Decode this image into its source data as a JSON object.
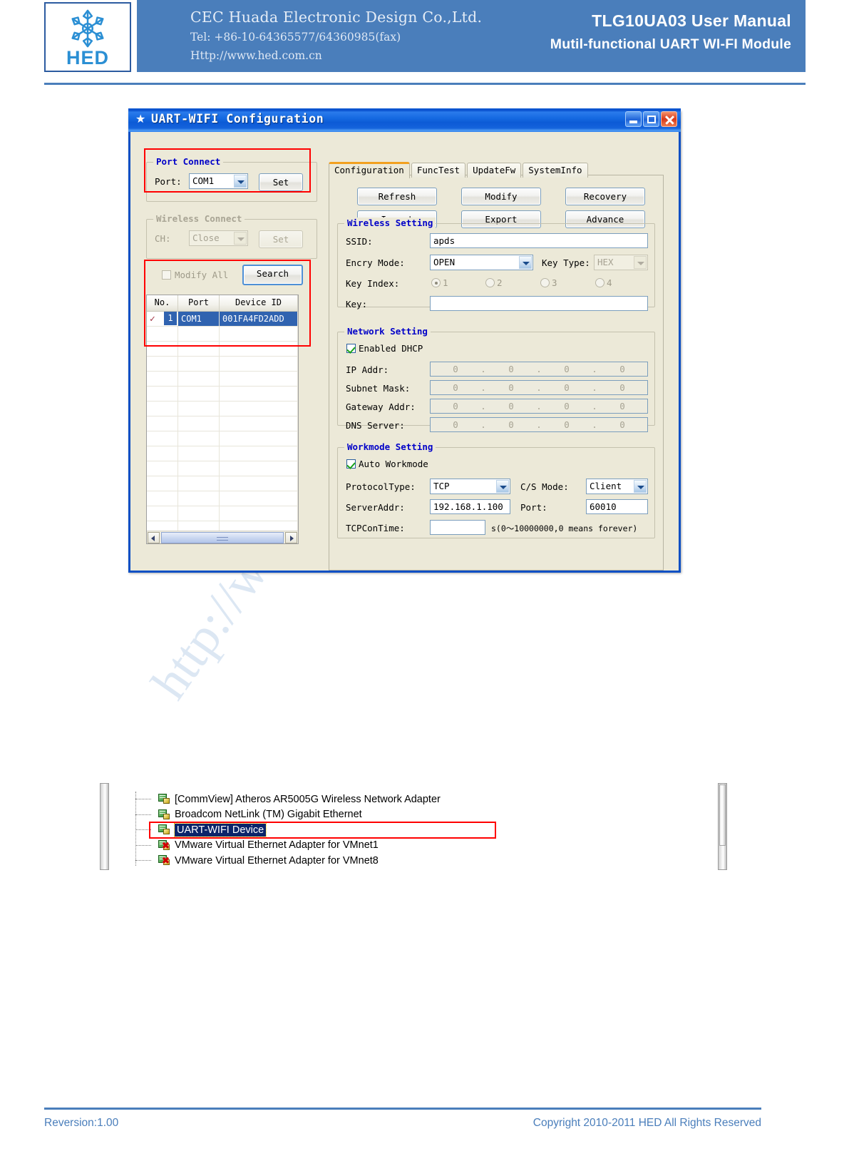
{
  "header": {
    "logo_text": "HED",
    "company_name": "CEC Huada Electronic Design Co.,Ltd.",
    "tel": "Tel: +86-10-64365577/64360985(fax)",
    "url": "Http://www.hed.com.cn",
    "manual_title": "TLG10UA03 User Manual",
    "manual_subtitle": "Mutil-functional UART WI-FI Module"
  },
  "watermark": {
    "text": "http://www.hed.com.cn"
  },
  "dialog": {
    "title": "UART-WIFI Configuration",
    "title_icon": "star-icon",
    "window_buttons": {
      "minimize": "minimize-icon",
      "maximize": "maximize-icon",
      "close": "close-icon"
    },
    "port_connect": {
      "group_label": "Port Connect",
      "port_label": "Port:",
      "port_value": "COM1",
      "set_button": "Set"
    },
    "wireless_connect": {
      "group_label": "Wireless Connect",
      "ch_label": "CH:",
      "ch_value": "Close",
      "set_button": "Set"
    },
    "search_row": {
      "modify_all_label": "Modify All",
      "modify_all_checked": false,
      "search_button": "Search"
    },
    "device_grid": {
      "columns": [
        "No.",
        "Port",
        "Device ID"
      ],
      "rows": [
        {
          "checked": true,
          "no": "1",
          "port": "COM1",
          "device_id": "001FA4FD2ADD",
          "selected": true
        }
      ],
      "empty_rows": 14
    },
    "tabs": [
      {
        "label": "Configuration",
        "active": true
      },
      {
        "label": "FuncTest",
        "active": false
      },
      {
        "label": "UpdateFw",
        "active": false
      },
      {
        "label": "SystemInfo",
        "active": false
      }
    ],
    "actions": [
      "Refresh",
      "Modify",
      "Recovery",
      "Import",
      "Export",
      "Advance"
    ],
    "wireless_setting": {
      "group_label": "Wireless Setting",
      "ssid_label": "SSID:",
      "ssid_value": "apds",
      "encry_mode_label": "Encry Mode:",
      "encry_mode_value": "OPEN",
      "key_type_label": "Key Type:",
      "key_type_value": "HEX",
      "key_index_label": "Key Index:",
      "key_index_options": [
        "1",
        "2",
        "3",
        "4"
      ],
      "key_index_selected": "1",
      "key_label": "Key:",
      "key_value": ""
    },
    "network_setting": {
      "group_label": "Network Setting",
      "dhcp_label": "Enabled DHCP",
      "dhcp_checked": true,
      "fields": [
        {
          "label": "IP Addr:",
          "octets": [
            "0",
            "0",
            "0",
            "0"
          ]
        },
        {
          "label": "Subnet Mask:",
          "octets": [
            "0",
            "0",
            "0",
            "0"
          ]
        },
        {
          "label": "Gateway Addr:",
          "octets": [
            "0",
            "0",
            "0",
            "0"
          ]
        },
        {
          "label": "DNS Server:",
          "octets": [
            "0",
            "0",
            "0",
            "0"
          ]
        }
      ]
    },
    "workmode_setting": {
      "group_label": "Workmode Setting",
      "auto_label": "Auto Workmode",
      "auto_checked": true,
      "protocol_label": "ProtocolType:",
      "protocol_value": "TCP",
      "cs_mode_label": "C/S Mode:",
      "cs_mode_value": "Client",
      "server_addr_label": "ServerAddr:",
      "server_addr_value": "192.168.1.100",
      "port_label": "Port:",
      "port_value": "60010",
      "tcpcontime_label": "TCPConTime:",
      "tcpcontime_value": "",
      "tcpcontime_hint": "s(0～10000000,0 means forever)"
    }
  },
  "adapter_list": {
    "items": [
      {
        "label": "[CommView] Atheros AR5005G Wireless Network Adapter",
        "disabled": false,
        "selected": false
      },
      {
        "label": "Broadcom NetLink (TM) Gigabit Ethernet",
        "disabled": false,
        "selected": false
      },
      {
        "label": "UART-WIFI Device",
        "disabled": false,
        "selected": true
      },
      {
        "label": "VMware Virtual Ethernet Adapter for VMnet1",
        "disabled": true,
        "selected": false
      },
      {
        "label": "VMware Virtual Ethernet Adapter for VMnet8",
        "disabled": true,
        "selected": false
      }
    ]
  },
  "footer": {
    "revision": "Reversion:1.00",
    "copyright": "Copyright 2010-2011 HED All Rights Reserved"
  },
  "colors": {
    "brand_blue": "#4A7EBB",
    "titlebar_blue": "#0A51CE",
    "group_label_blue": "#0000C8",
    "annotation_red": "#FF0000",
    "selection_blue": "#3063B0",
    "tab_accent": "#F2A01F"
  }
}
